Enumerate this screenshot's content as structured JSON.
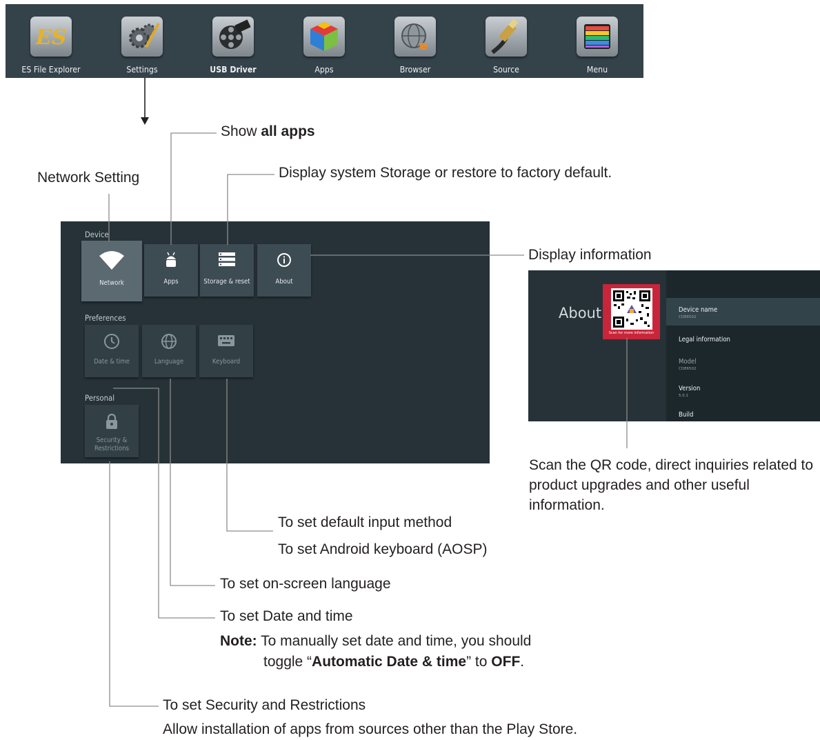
{
  "launcher": {
    "apps": [
      {
        "label": "ES File Explorer",
        "icon": "es-file-explorer-icon"
      },
      {
        "label": "Settings",
        "icon": "settings-gears-icon"
      },
      {
        "label": "USB Driver",
        "icon": "film-reel-icon"
      },
      {
        "label": "Apps",
        "icon": "colored-cube-icon"
      },
      {
        "label": "Browser",
        "icon": "globe-browser-icon"
      },
      {
        "label": "Source",
        "icon": "hdmi-cable-icon"
      },
      {
        "label": "Menu",
        "icon": "color-bars-icon"
      }
    ]
  },
  "annotations": {
    "show_all_apps_prefix": "Show ",
    "show_all_apps_bold": "all apps",
    "network_setting": "Network Setting",
    "storage": "Display system Storage or restore to factory default.",
    "display_information": "Display information",
    "qr_caption": "Scan the QR code, direct inquiries related to product upgrades and other useful information.",
    "input_method": "To set default input method",
    "android_keyboard": "To set Android keyboard (AOSP)",
    "language": "To set on-screen language",
    "date_time": "To set Date and time",
    "note_label": "Note:",
    "note_text_1": " To manually set date and time, you should",
    "note_text_2a": "toggle “",
    "note_text_2b": "Automatic Date & time",
    "note_text_2c": "” to ",
    "note_text_2d": "OFF",
    "note_text_2e": ".",
    "security": "To set Security and Restrictions",
    "security_detail": "Allow installation of apps from sources other than the Play Store."
  },
  "settings": {
    "sections": {
      "device": "Device",
      "preferences": "Preferences",
      "personal": "Personal"
    },
    "device_items": [
      {
        "label": "Network",
        "icon": "wifi-icon"
      },
      {
        "label": "Apps",
        "icon": "android-icon"
      },
      {
        "label": "Storage & reset",
        "icon": "storage-icon"
      },
      {
        "label": "About",
        "icon": "info-icon"
      }
    ],
    "preference_items": [
      {
        "label": "Date & time",
        "icon": "clock-icon"
      },
      {
        "label": "Language",
        "icon": "globe-icon"
      },
      {
        "label": "Keyboard",
        "icon": "keyboard-icon"
      }
    ],
    "personal_items": [
      {
        "label_line1": "Security &",
        "label_line2": "Restrictions",
        "icon": "lock-icon"
      }
    ]
  },
  "about": {
    "title": "About",
    "qr_scan_text": "Scan for more information",
    "rows": [
      {
        "title": "Device name",
        "value": "CDE6502"
      },
      {
        "title": "Legal information",
        "value": ""
      },
      {
        "title": "Model",
        "value": "CDE6502"
      },
      {
        "title": "Version",
        "value": "5.0.1"
      },
      {
        "title": "Build",
        "value": ""
      }
    ]
  },
  "colors": {
    "launcher_bg": "#34424a",
    "screen_bg": "#263238",
    "qr_red": "#c9253a"
  }
}
